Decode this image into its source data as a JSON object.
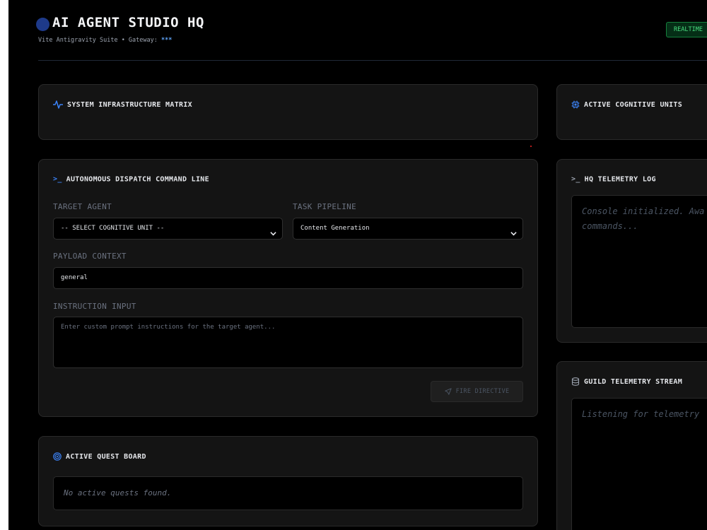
{
  "header": {
    "title": "AI AGENT STUDIO HQ",
    "subtitle_prefix": "Vite Antigravity Suite • Gateway: ",
    "gateway_value": "***",
    "status_badge": "REALTIME"
  },
  "infra_panel": {
    "title": "SYSTEM INFRASTRUCTURE MATRIX",
    "icon": "activity-icon"
  },
  "units_panel": {
    "title": "ACTIVE COGNITIVE UNITS",
    "icon": "cpu-icon"
  },
  "dispatch": {
    "title": "AUTONOMOUS DISPATCH COMMAND LINE",
    "icon_text": ">_",
    "target_agent_label": "TARGET AGENT",
    "target_agent_value": "-- SELECT COGNITIVE UNIT --",
    "task_pipeline_label": "TASK PIPELINE",
    "task_pipeline_value": "Content Generation",
    "payload_label": "PAYLOAD CONTEXT",
    "payload_value": "general",
    "instruction_label": "INSTRUCTION INPUT",
    "instruction_placeholder": "Enter custom prompt instructions for the target agent...",
    "fire_button": "FIRE DIRECTIVE"
  },
  "telemetry_log": {
    "title": "HQ TELEMETRY LOG",
    "icon_text": ">_",
    "text": "Console initialized. Awa commands..."
  },
  "quest_board": {
    "title": "ACTIVE QUEST BOARD",
    "empty_text": "No active quests found."
  },
  "guild_stream": {
    "title": "GUILD TELEMETRY STREAM",
    "text": "Listening for telemetry"
  },
  "colors": {
    "accent": "#3b82f6",
    "background": "#000000",
    "panel": "#141414",
    "status_green": "#4ade80"
  }
}
